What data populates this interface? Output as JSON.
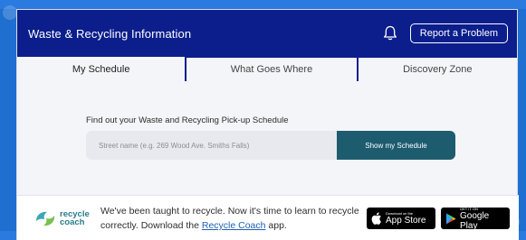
{
  "header": {
    "title": "Waste & Recycling Information",
    "report_button": "Report a Problem",
    "bell_icon": "bell-icon"
  },
  "tabs": [
    {
      "label": "My Schedule",
      "active": true
    },
    {
      "label": "What Goes Where",
      "active": false
    },
    {
      "label": "Discovery Zone",
      "active": false
    }
  ],
  "schedule": {
    "prompt": "Find out your Waste and Recycling Pick-up Schedule",
    "street_placeholder": "Street name (e.g. 269 Wood Ave. Smiths Falls)",
    "button_label": "Show my Schedule"
  },
  "footer": {
    "logo_line1": "recycle",
    "logo_line2": "coach",
    "text_before": "We've been taught to recycle. Now it's time to learn to recycle correctly. Download the ",
    "link_text": "Recycle Coach",
    "text_after": " app.",
    "app_store_small": "Download on the",
    "app_store_big": "App Store",
    "google_play_small": "GET IT ON",
    "google_play_big": "Google Play"
  },
  "colors": {
    "header": "#0b1e8c",
    "button": "#1d5c6f",
    "background": "#1f6fd1"
  }
}
